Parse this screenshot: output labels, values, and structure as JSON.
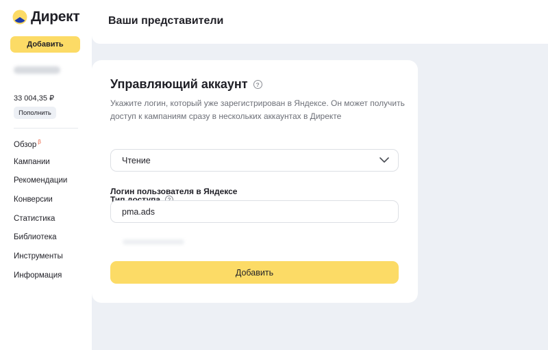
{
  "sidebar": {
    "logo_text": "Директ",
    "add_button": "Добавить",
    "balance": "33 004,35 ₽",
    "topup_button": "Пополнить",
    "nav": [
      {
        "label": "Обзор",
        "badge": "β"
      },
      {
        "label": "Кампании"
      },
      {
        "label": "Рекомендации"
      },
      {
        "label": "Конверсии"
      },
      {
        "label": "Статистика"
      },
      {
        "label": "Библиотека"
      },
      {
        "label": "Инструменты"
      },
      {
        "label": "Информация"
      }
    ]
  },
  "header": {
    "title": "Ваши представители"
  },
  "card": {
    "title": "Управляющий аккаунт",
    "description": "Укажите логин, который уже зарегистрирован в Яндексе. Он может получить доступ к кампаниям сразу в нескольких аккаунтах в Директе",
    "access_label": "Тип доступа",
    "access_value": "Чтение",
    "login_label": "Логин пользователя в Яндексе",
    "login_value": "pma.ads",
    "submit_button": "Добавить"
  },
  "colors": {
    "accent": "#fcdb66",
    "background": "#edf0f5",
    "logo_blue": "#1c3aa9",
    "logo_yellow": "#fcdb66"
  }
}
